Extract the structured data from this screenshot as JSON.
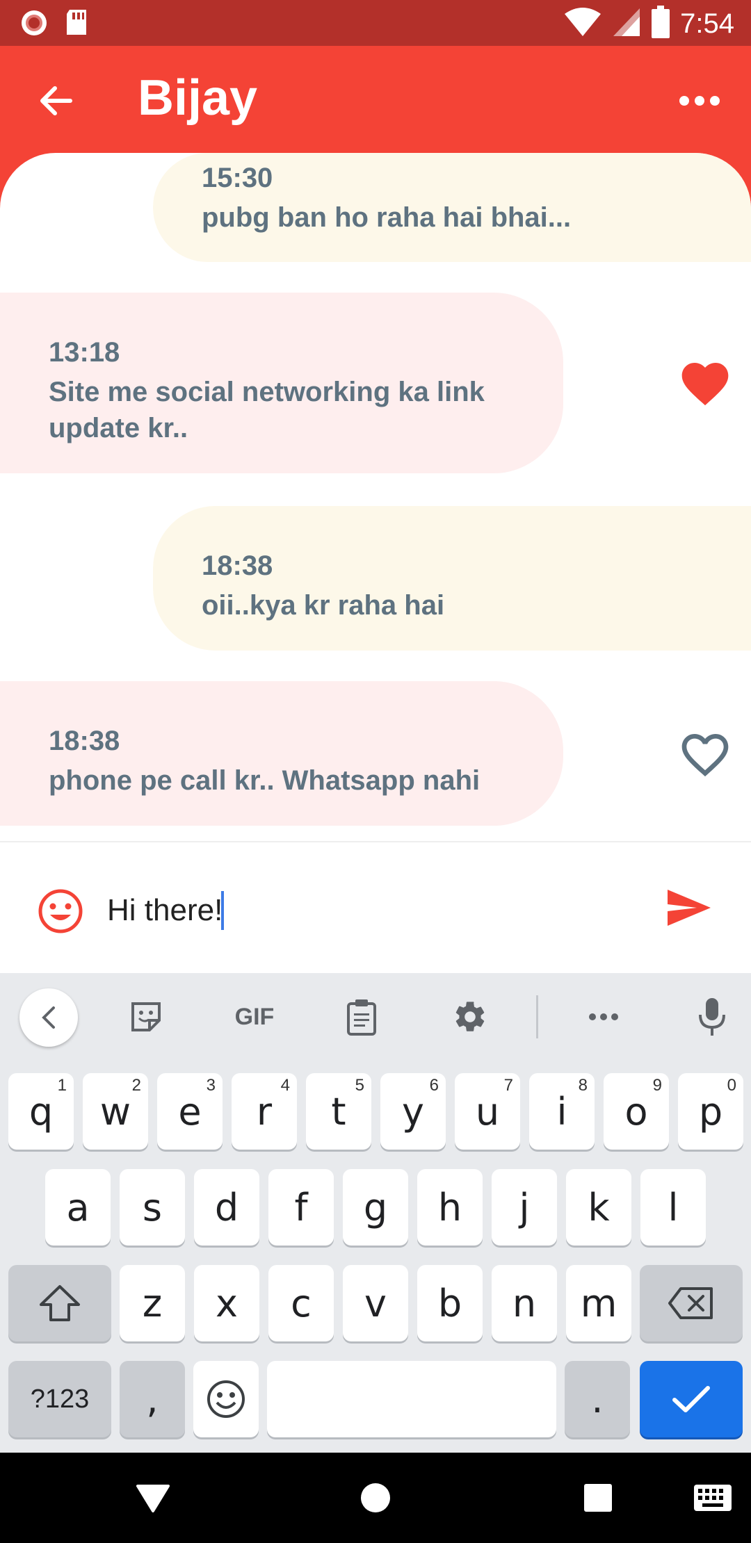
{
  "status_bar": {
    "time": "7:54"
  },
  "header": {
    "title": "Bijay"
  },
  "messages": [
    {
      "direction": "sent",
      "time": "15:30",
      "text": "pubg ban ho raha hai bhai..."
    },
    {
      "direction": "received",
      "time": "13:18",
      "text": "Site me social networking ka link update kr..",
      "liked": true
    },
    {
      "direction": "sent",
      "time": "18:38",
      "text": "oii..kya kr raha hai"
    },
    {
      "direction": "received",
      "time": "18:38",
      "text": "phone pe call kr.. Whatsapp nahi",
      "liked": false
    }
  ],
  "composer": {
    "value": "Hi there!"
  },
  "keyboard": {
    "toolbar": {
      "gif": "GIF"
    },
    "row1": [
      {
        "key": "q",
        "hint": "1"
      },
      {
        "key": "w",
        "hint": "2"
      },
      {
        "key": "e",
        "hint": "3"
      },
      {
        "key": "r",
        "hint": "4"
      },
      {
        "key": "t",
        "hint": "5"
      },
      {
        "key": "y",
        "hint": "6"
      },
      {
        "key": "u",
        "hint": "7"
      },
      {
        "key": "i",
        "hint": "8"
      },
      {
        "key": "o",
        "hint": "9"
      },
      {
        "key": "p",
        "hint": "0"
      }
    ],
    "row2": [
      "a",
      "s",
      "d",
      "f",
      "g",
      "h",
      "j",
      "k",
      "l"
    ],
    "row3": [
      "z",
      "x",
      "c",
      "v",
      "b",
      "n",
      "m"
    ],
    "symbols_label": "?123",
    "comma": ",",
    "period": "."
  },
  "colors": {
    "status_bar": "#b3302a",
    "app_bar": "#f44336",
    "sent_bubble": "#fdf8e9",
    "received_bubble": "#feeeee",
    "message_text": "#5e7280",
    "accent": "#f44336",
    "enter_key": "#1a73e8"
  }
}
